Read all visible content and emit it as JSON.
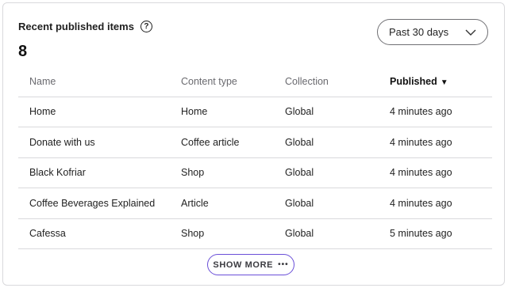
{
  "widget": {
    "title": "Recent published items",
    "count": "8",
    "help_icon": "question-circle-icon",
    "help_glyph": "?"
  },
  "range": {
    "selected": "Past 30 days",
    "icon": "chevron-down-icon"
  },
  "table": {
    "columns": {
      "name": "Name",
      "content_type": "Content type",
      "collection": "Collection",
      "published": "Published"
    },
    "sort_glyph": "▼",
    "rows": [
      {
        "name": "Home",
        "content_type": "Home",
        "collection": "Global",
        "published": "4 minutes ago"
      },
      {
        "name": "Donate with us",
        "content_type": "Coffee article",
        "collection": "Global",
        "published": "4 minutes ago"
      },
      {
        "name": "Black Kofriar",
        "content_type": "Shop",
        "collection": "Global",
        "published": "4 minutes ago"
      },
      {
        "name": "Coffee Beverages Explained",
        "content_type": "Article",
        "collection": "Global",
        "published": "4 minutes ago"
      },
      {
        "name": "Cafessa",
        "content_type": "Shop",
        "collection": "Global",
        "published": "5 minutes ago"
      }
    ]
  },
  "footer": {
    "show_more_label": "SHOW MORE",
    "dots": "•••",
    "accent": "#6a4fd8"
  }
}
